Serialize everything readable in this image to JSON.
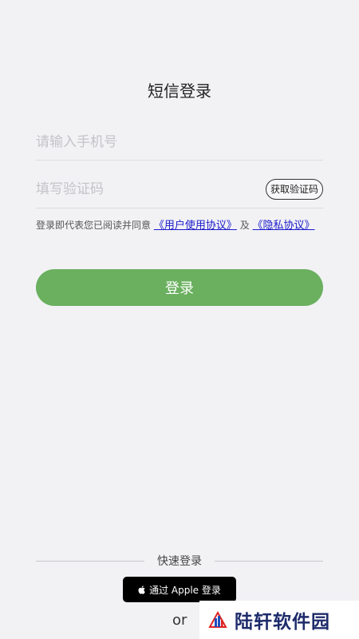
{
  "page": {
    "title": "短信登录"
  },
  "phone": {
    "placeholder": "请输入手机号",
    "value": ""
  },
  "code": {
    "placeholder": "填写验证码",
    "value": "",
    "get_code_label": "获取验证码"
  },
  "agreement": {
    "prefix": "登录即代表您已阅读并同意",
    "user_agreement": "《用户使用协议》",
    "and": "及",
    "privacy_policy": "《隐私协议》"
  },
  "login_button": {
    "label": "登录"
  },
  "quick_login": {
    "label": "快速登录",
    "apple_label": "通过 Apple 登录",
    "or_label": "or"
  },
  "watermark": {
    "text": "陆轩软件园",
    "icon": "building-logo"
  },
  "colors": {
    "background": "#f2f2f5",
    "primary": "#6ab05f",
    "link": "#1a1acc",
    "apple_button": "#000000"
  }
}
